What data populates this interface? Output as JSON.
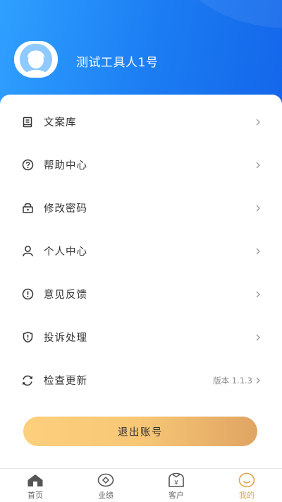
{
  "header": {
    "username": "测试工具人1号"
  },
  "menu": {
    "items": [
      {
        "label": "文案库"
      },
      {
        "label": "帮助中心"
      },
      {
        "label": "修改密码"
      },
      {
        "label": "个人中心"
      },
      {
        "label": "意见反馈"
      },
      {
        "label": "投诉处理"
      },
      {
        "label": "检查更新",
        "extra": "版本 1.1.3"
      }
    ]
  },
  "logout": {
    "label": "退出账号"
  },
  "tabs": [
    {
      "label": "首页",
      "icon": "home-icon"
    },
    {
      "label": "业绩",
      "icon": "performance-icon"
    },
    {
      "label": "客户",
      "icon": "customer-icon"
    },
    {
      "label": "我的",
      "icon": "profile-smile-icon",
      "active": true
    }
  ],
  "colors": {
    "header_start": "#2fa0ff",
    "header_end": "#1466ea",
    "accent": "#e2a24a",
    "button_start": "#fdd07d",
    "button_end": "#dfa463"
  }
}
